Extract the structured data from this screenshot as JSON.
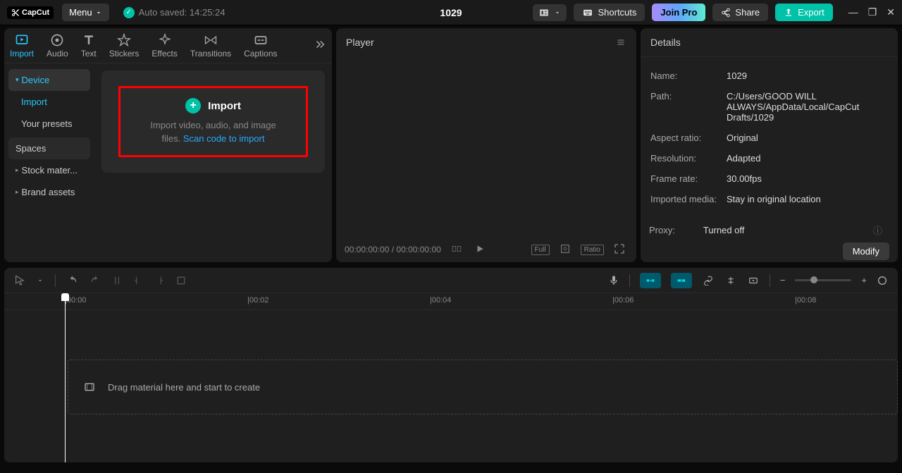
{
  "titlebar": {
    "logo": "CapCut",
    "menu": "Menu",
    "autosave": "Auto saved: 14:25:24",
    "project": "1029",
    "shortcuts": "Shortcuts",
    "joinPro": "Join Pro",
    "share": "Share",
    "export": "Export"
  },
  "tabs": {
    "import": "Import",
    "audio": "Audio",
    "text": "Text",
    "stickers": "Stickers",
    "effects": "Effects",
    "transitions": "Transitions",
    "captions": "Captions"
  },
  "sidebar": {
    "device": "Device",
    "import": "Import",
    "presets": "Your presets",
    "spaces": "Spaces",
    "stock": "Stock mater...",
    "brand": "Brand assets"
  },
  "importCard": {
    "title": "Import",
    "desc": "Import video, audio, and image files. ",
    "link": "Scan code to import"
  },
  "player": {
    "title": "Player",
    "time": "00:00:00:00 / 00:00:00:00",
    "full": "Full",
    "ratio": "Ratio"
  },
  "details": {
    "title": "Details",
    "name": {
      "label": "Name:",
      "value": "1029"
    },
    "path": {
      "label": "Path:",
      "value": "C:/Users/GOOD WILL ALWAYS/AppData/Local/CapCut Drafts/1029"
    },
    "aspect": {
      "label": "Aspect ratio:",
      "value": "Original"
    },
    "resolution": {
      "label": "Resolution:",
      "value": "Adapted"
    },
    "framerate": {
      "label": "Frame rate:",
      "value": "30.00fps"
    },
    "imported": {
      "label": "Imported media:",
      "value": "Stay in original location"
    },
    "proxy": {
      "label": "Proxy:",
      "value": "Turned off"
    },
    "modify": "Modify"
  },
  "timeline": {
    "ruler": [
      "00:00",
      "00:02",
      "00:04",
      "00:06",
      "00:08"
    ],
    "dropHint": "Drag material here and start to create"
  }
}
